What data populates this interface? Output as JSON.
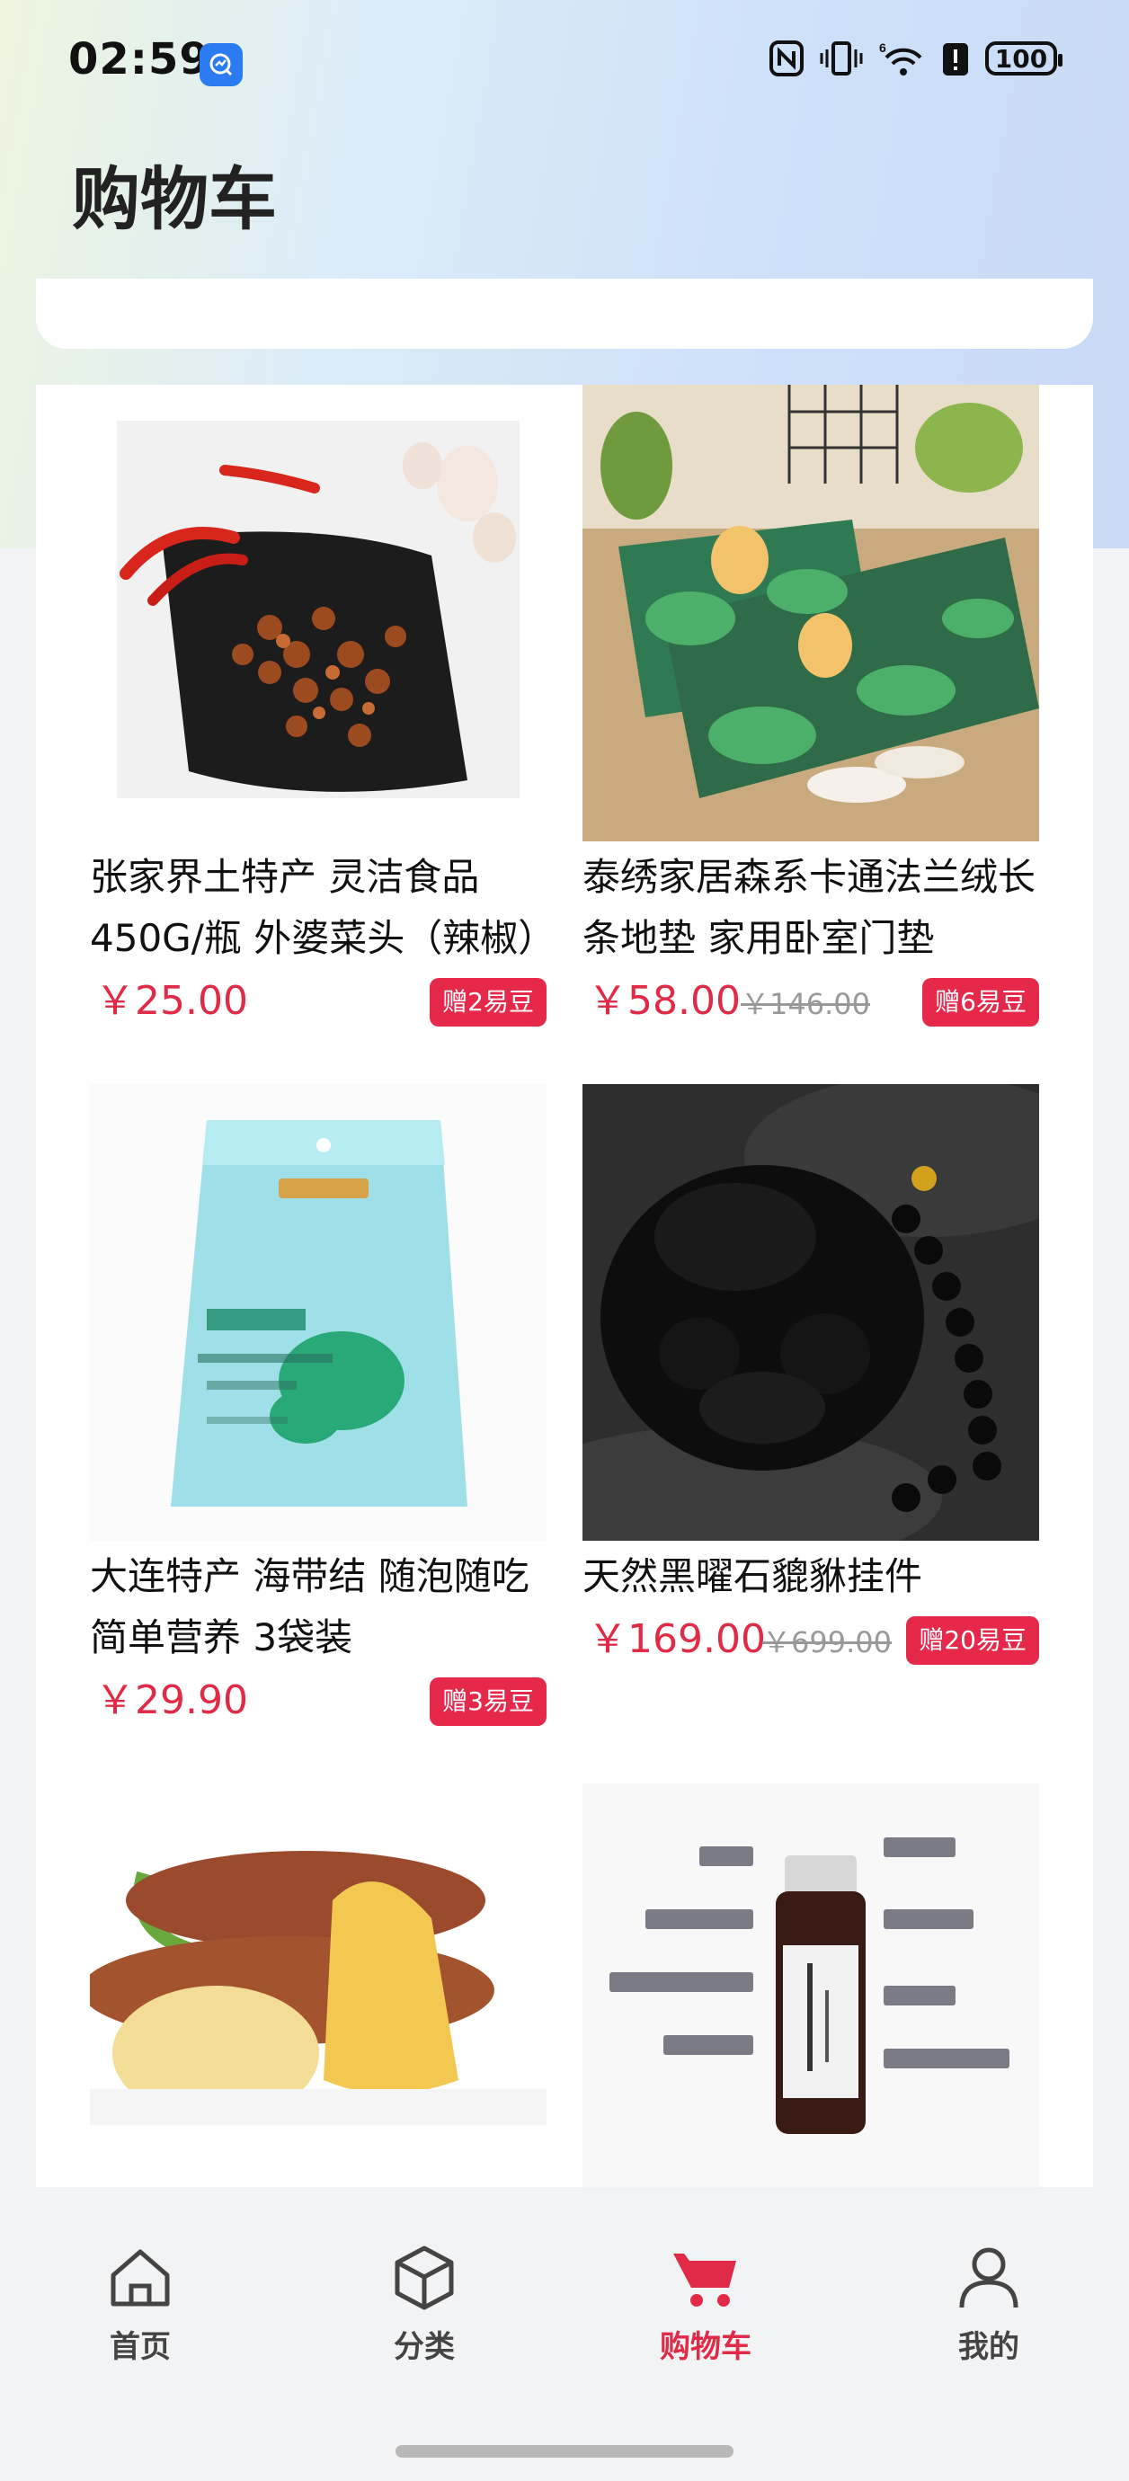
{
  "status_bar": {
    "time": "02:59",
    "battery": "100",
    "icons": [
      "nfc-icon",
      "vibrate-icon",
      "wifi-6-icon",
      "alert-icon",
      "battery-icon"
    ]
  },
  "page": {
    "title": "购物车"
  },
  "products": [
    {
      "name": "张家界土特产 灵洁食品450G/瓶 外婆菜头（辣椒）",
      "price": "￥25.00",
      "original_price": "",
      "bonus": "赠2易豆"
    },
    {
      "name": "泰绣家居森系卡通法兰绒长条地垫 家用卧室门垫",
      "price": "￥58.00",
      "original_price": "￥146.00",
      "bonus": "赠6易豆"
    },
    {
      "name": "大连特产  海带结 随泡随吃 简单营养 3袋装",
      "price": "￥29.90",
      "original_price": "",
      "bonus": "赠3易豆"
    },
    {
      "name": "天然黑曜石貔貅挂件",
      "price": "￥169.00",
      "original_price": "￥699.00",
      "bonus": "赠20易豆"
    },
    {
      "name": "",
      "price": "",
      "original_price": "",
      "bonus": ""
    },
    {
      "name": "",
      "price": "",
      "original_price": "",
      "bonus": ""
    }
  ],
  "tabs": [
    {
      "label": "首页",
      "icon": "home-icon",
      "active": false
    },
    {
      "label": "分类",
      "icon": "cube-icon",
      "active": false
    },
    {
      "label": "购物车",
      "icon": "cart-icon",
      "active": true
    },
    {
      "label": "我的",
      "icon": "user-icon",
      "active": false
    }
  ],
  "colors": {
    "accent": "#e02a46",
    "bonus_badge": "#e6284b"
  }
}
